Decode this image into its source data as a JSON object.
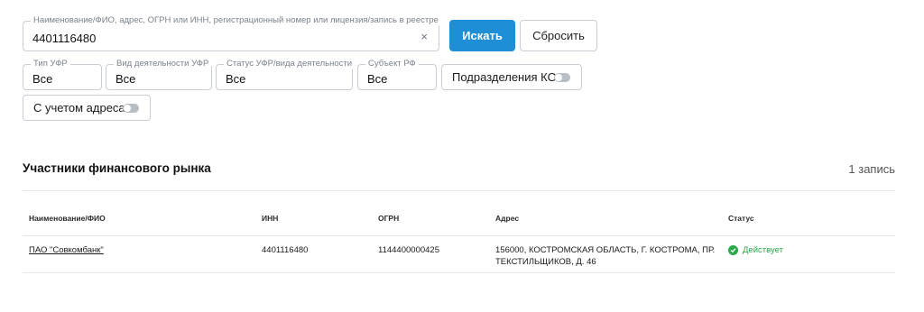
{
  "search": {
    "label": "Наименование/ФИО, адрес, ОГРН или ИНН, регистрационный номер или лицензия/запись в реестре",
    "value": "4401116480",
    "clear_glyph": "×"
  },
  "buttons": {
    "search": "Искать",
    "reset": "Сбросить"
  },
  "filters": {
    "type": {
      "label": "Тип УФР",
      "value": "Все"
    },
    "activity": {
      "label": "Вид деятельности УФР",
      "value": "Все"
    },
    "status": {
      "label": "Статус УФР/вида деятельности",
      "value": "Все"
    },
    "region": {
      "label": "Субъект РФ",
      "value": "Все"
    }
  },
  "toggles": {
    "divisions": {
      "label": "Подразделения КО",
      "on": false
    },
    "address": {
      "label": "С учетом адреса",
      "on": false
    }
  },
  "results": {
    "title": "Участники финансового рынка",
    "count": "1 запись",
    "columns": [
      "Наименование/ФИО",
      "ИНН",
      "ОГРН",
      "Адрес",
      "Статус"
    ],
    "rows": [
      {
        "name": "ПАО \"Совкомбанк\"",
        "inn": "4401116480",
        "ogrn": "1144400000425",
        "address": "156000, КОСТРОМСКАЯ ОБЛАСТЬ, Г. КОСТРОМА, ПР. ТЕКСТИЛЬЩИКОВ, Д. 46",
        "status": "Действует"
      }
    ]
  },
  "colors": {
    "primary": "#1e8fd7",
    "status_active": "#2aa84a",
    "border": "#c9ced6"
  }
}
